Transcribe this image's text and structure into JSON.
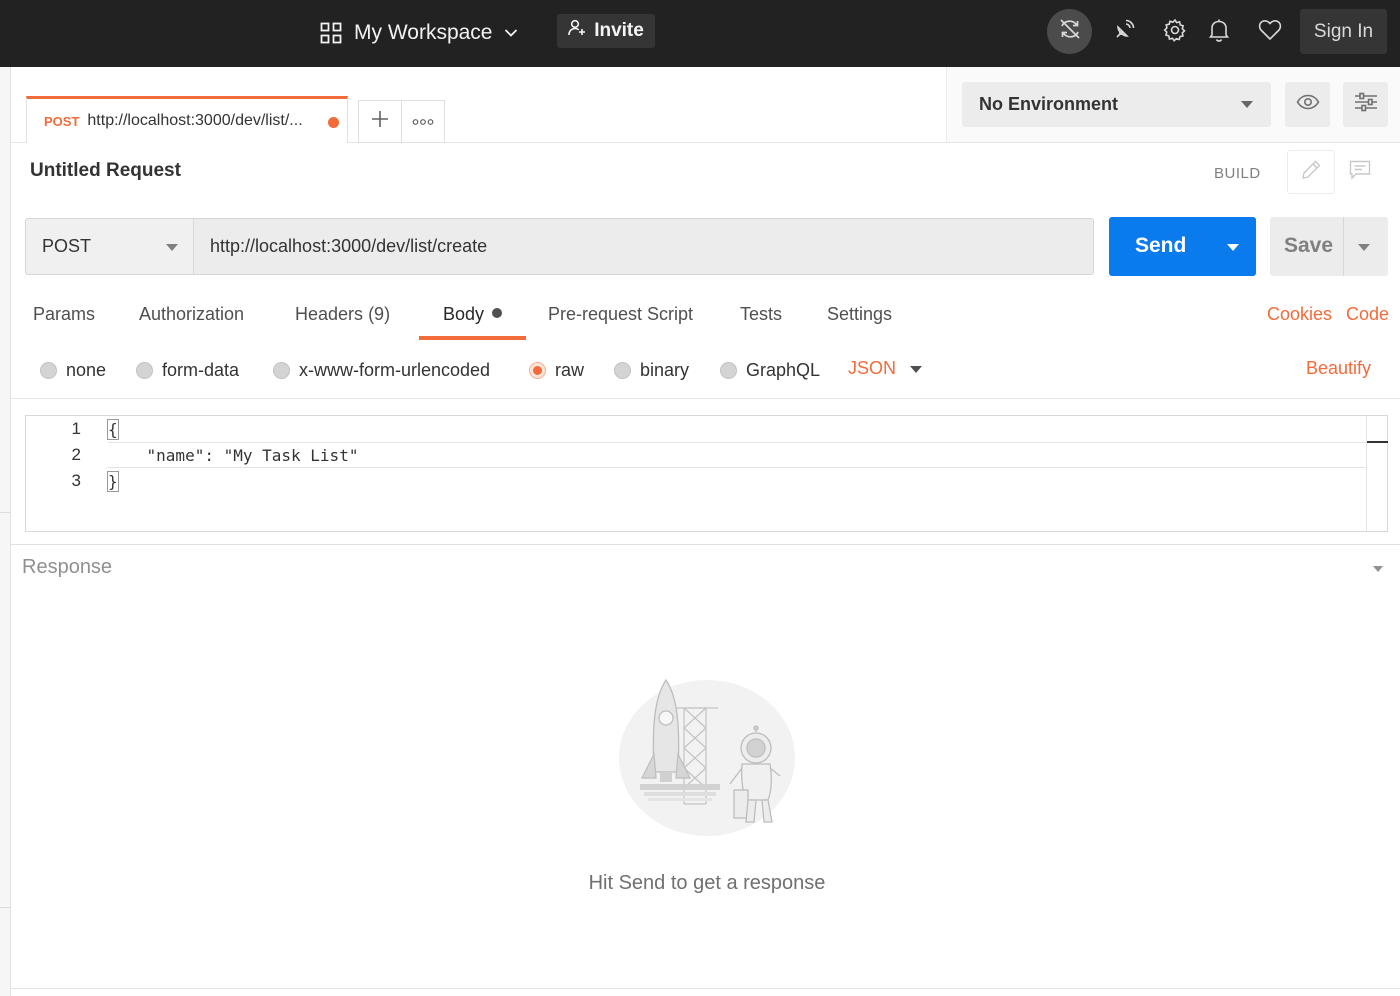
{
  "header": {
    "workspace_label": "My Workspace",
    "invite_label": "Invite",
    "signin_label": "Sign In"
  },
  "tab": {
    "method": "POST",
    "url": "http://localhost:3000/dev/list/..."
  },
  "environment": {
    "selected": "No Environment"
  },
  "request": {
    "name": "Untitled Request",
    "mode_label": "BUILD",
    "method": "POST",
    "url": "http://localhost:3000/dev/list/create",
    "send_label": "Send",
    "save_label": "Save"
  },
  "subtabs": {
    "params": "Params",
    "authorization": "Authorization",
    "headers": "Headers",
    "headers_count": "(9)",
    "body": "Body",
    "prerequest": "Pre-request Script",
    "tests": "Tests",
    "settings": "Settings",
    "cookies": "Cookies",
    "code": "Code"
  },
  "body_types": {
    "none": "none",
    "form_data": "form-data",
    "urlencoded": "x-www-form-urlencoded",
    "raw": "raw",
    "binary": "binary",
    "graphql": "GraphQL",
    "selected": "raw",
    "format": "JSON",
    "beautify": "Beautify"
  },
  "editor": {
    "line_numbers": [
      "1",
      "2",
      "3"
    ],
    "lines": [
      "{",
      "    \"name\": \"My Task List\"",
      "}"
    ]
  },
  "response": {
    "title": "Response",
    "hint": "Hit Send to get a response"
  },
  "colors": {
    "accent": "#f26b3a",
    "send_blue": "#097bed",
    "header_bg": "#222222"
  },
  "icons": [
    "workspace-grid-icon",
    "chevron-down-icon",
    "add-user-icon",
    "sync-off-icon",
    "satellite-icon",
    "gear-icon",
    "bell-icon",
    "heart-icon",
    "plus-icon",
    "ellipsis-icon",
    "eye-icon",
    "sliders-icon",
    "pencil-icon",
    "comment-icon"
  ]
}
